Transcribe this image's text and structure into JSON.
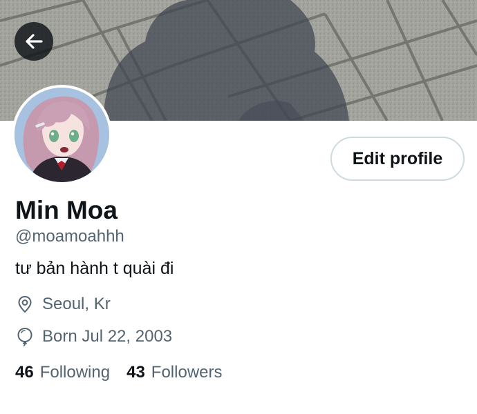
{
  "header": {
    "back_icon": "arrow-left-icon"
  },
  "profile": {
    "name": "Min Moa",
    "handle": "@moamoahhh",
    "bio": "tư bản hành t quài đi",
    "location": "Seoul, Kr",
    "location_icon": "location-pin-icon",
    "birthday": "Born Jul 22, 2003",
    "birthday_icon": "balloon-icon",
    "edit_label": "Edit profile"
  },
  "stats": {
    "following_count": "46",
    "following_label": "Following",
    "followers_count": "43",
    "followers_label": "Followers"
  },
  "colors": {
    "text_primary": "#0f1419",
    "text_secondary": "#536471",
    "button_border": "#cfd9de"
  }
}
